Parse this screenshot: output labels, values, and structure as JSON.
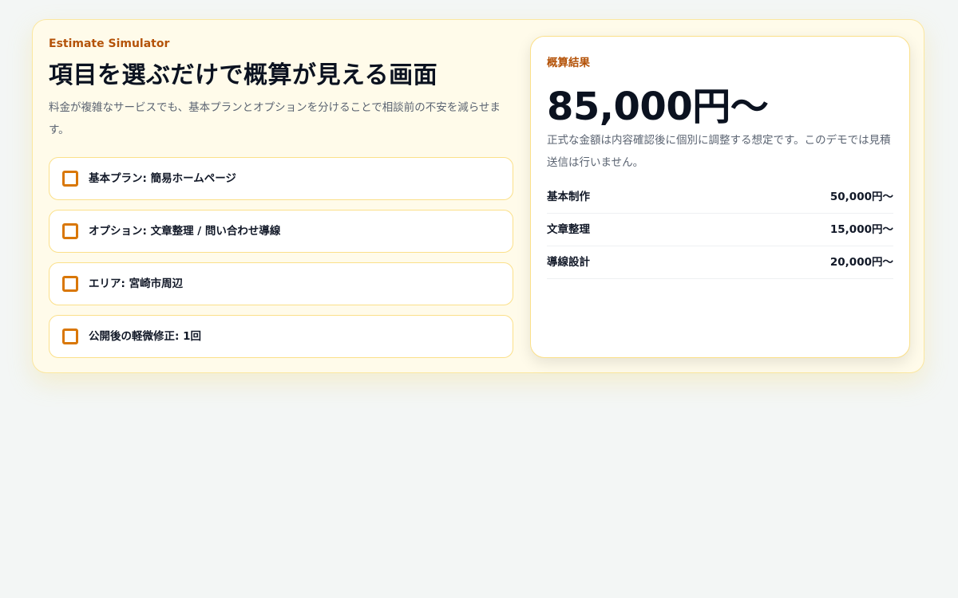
{
  "simulator": {
    "eyebrow": "Estimate Simulator",
    "title": "項目を選ぶだけで概算が見える画面",
    "description": "料金が複雑なサービスでも、基本プランとオプションを分けることで相談前の不安を減らせます。",
    "options": [
      {
        "label": "基本プラン: 簡易ホームページ",
        "checked": false
      },
      {
        "label": "オプション: 文章整理 / 問い合わせ導線",
        "checked": false
      },
      {
        "label": "エリア: 宮崎市周辺",
        "checked": false
      },
      {
        "label": "公開後の軽微修正: 1回",
        "checked": false
      }
    ]
  },
  "result": {
    "eyebrow": "概算結果",
    "total": "85,000円〜",
    "note": "正式な金額は内容確認後に個別に調整する想定です。このデモでは見積送信は行いません。",
    "breakdown": [
      {
        "label": "基本制作",
        "value": "50,000円〜"
      },
      {
        "label": "文章整理",
        "value": "15,000円〜"
      },
      {
        "label": "導線設計",
        "value": "20,000円〜"
      }
    ]
  },
  "colors": {
    "accent": "#d97706",
    "eyebrow": "#b45309",
    "panel_bg": "#fffbea",
    "panel_border": "#fbe7a0"
  }
}
